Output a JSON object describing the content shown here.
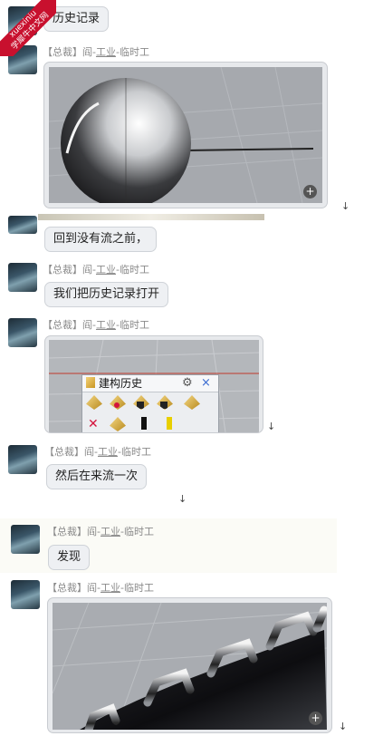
{
  "watermark": {
    "line1": "xuexiniu",
    "line2": "学犀牛中文网"
  },
  "messages": [
    {
      "text": "历史记录"
    },
    {
      "sender": {
        "tag": "【总裁】",
        "name1": "阎-",
        "name2": "工业",
        "name3": "-临时工"
      }
    },
    {
      "text": "回到没有流之前，"
    },
    {
      "sender": {
        "tag": "【总裁】",
        "name1": "阎-",
        "name2": "工业",
        "name3": "-临时工"
      },
      "text": "我们把历史记录打开"
    },
    {
      "sender": {
        "tag": "【总裁】",
        "name1": "阎-",
        "name2": "工业",
        "name3": "-临时工"
      },
      "panel_title": "建构历史"
    },
    {
      "sender": {
        "tag": "【总裁】",
        "name1": "阎-",
        "name2": "工业",
        "name3": "-临时工"
      },
      "text": "然后在来流一次"
    },
    {
      "sender": {
        "tag": "【总裁】",
        "name1": "阎-",
        "name2": "工业",
        "name3": "-临时工"
      },
      "text": "发现"
    },
    {
      "sender": {
        "tag": "【总裁】",
        "name1": "阎-",
        "name2": "工业",
        "name3": "-临时工"
      }
    }
  ],
  "icons": {
    "download": "down-arrow-icon",
    "zoom": "zoom-in-icon",
    "settings": "gear-icon",
    "close": "close-icon"
  },
  "glyphs": {
    "download": "↓",
    "zoom": "+",
    "settings": "⚙",
    "close": "×"
  },
  "colors": {
    "watermark": "#c8102e",
    "bubble": "#eef0f3",
    "viewport": "#a6a9ae"
  }
}
